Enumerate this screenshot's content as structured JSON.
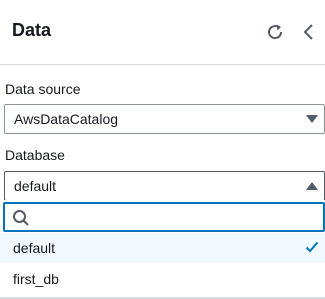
{
  "header": {
    "title": "Data",
    "refresh_icon": "refresh-icon",
    "collapse_icon": "chevron-left-icon"
  },
  "data_source": {
    "label": "Data source",
    "value": "AwsDataCatalog"
  },
  "database": {
    "label": "Database",
    "value": "default",
    "search_placeholder": "",
    "options": [
      {
        "label": "default",
        "selected": true
      },
      {
        "label": "first_db",
        "selected": false
      }
    ]
  },
  "colors": {
    "accent": "#0073bb",
    "selected_bg": "#f1faff",
    "border": "#879596"
  }
}
